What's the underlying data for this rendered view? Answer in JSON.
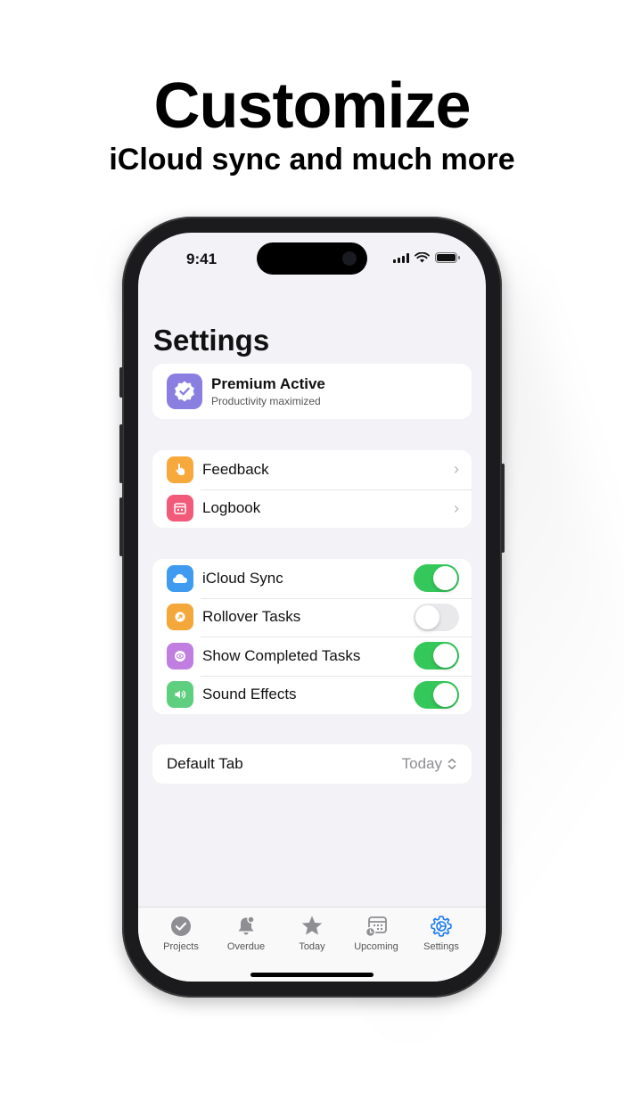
{
  "headline": "Customize",
  "subhead": "iCloud sync and much more",
  "status": {
    "time": "9:41"
  },
  "settings": {
    "title": "Settings",
    "premium": {
      "title": "Premium Active",
      "subtitle": "Productivity maximized",
      "color": "#8a7fe0"
    },
    "links": [
      {
        "label": "Feedback",
        "icon": "hand-tap-icon",
        "color": "#f7a93b"
      },
      {
        "label": "Logbook",
        "icon": "calendar-icon",
        "color": "#f25a7a"
      }
    ],
    "toggles": [
      {
        "label": "iCloud Sync",
        "icon": "cloud-icon",
        "color": "#3e9bf0",
        "on": true
      },
      {
        "label": "Rollover Tasks",
        "icon": "rollover-icon",
        "color": "#f5a83a",
        "on": false
      },
      {
        "label": "Show Completed Tasks",
        "icon": "eye-icon",
        "color": "#c07fe0",
        "on": true
      },
      {
        "label": "Sound Effects",
        "icon": "speaker-icon",
        "color": "#5ecf7f",
        "on": true
      }
    ],
    "default_tab": {
      "label": "Default Tab",
      "value": "Today"
    }
  },
  "tabbar": {
    "tabs": [
      {
        "label": "Projects",
        "icon": "checkmark-circle-icon"
      },
      {
        "label": "Overdue",
        "icon": "bell-icon"
      },
      {
        "label": "Today",
        "icon": "star-icon"
      },
      {
        "label": "Upcoming",
        "icon": "calendar-clock-icon"
      },
      {
        "label": "Settings",
        "icon": "gear-icon",
        "active": true
      }
    ],
    "active_color": "#1a7cf0"
  }
}
